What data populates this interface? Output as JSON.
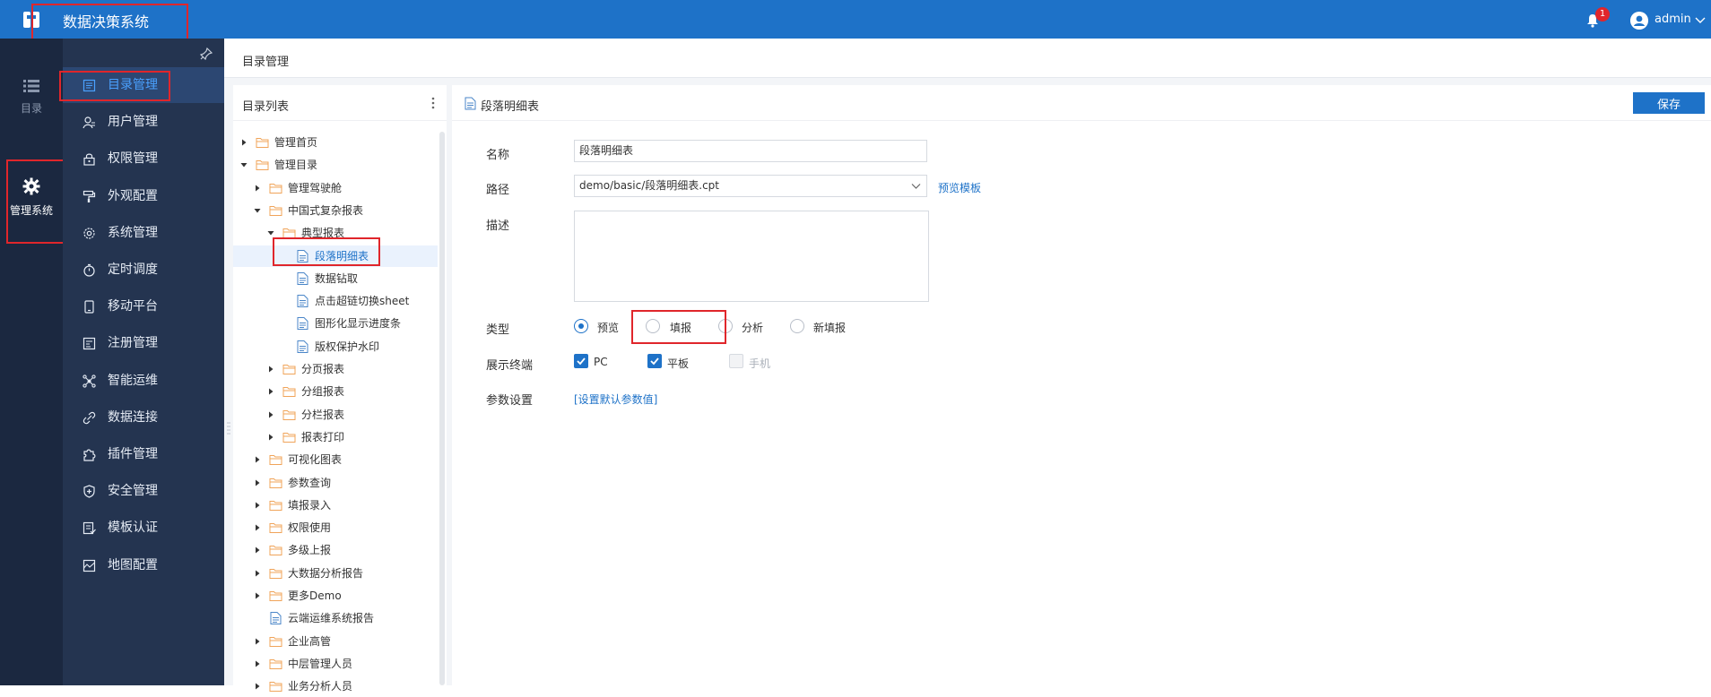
{
  "app": {
    "title": "数据决策系统",
    "user": "admin",
    "notifications": "1"
  },
  "rail": [
    {
      "label": "目录",
      "icon": "list-icon"
    },
    {
      "label": "管理系统",
      "icon": "gear-icon"
    }
  ],
  "menu": [
    {
      "label": "目录管理",
      "icon": "catalog-icon"
    },
    {
      "label": "用户管理",
      "icon": "user-icon"
    },
    {
      "label": "权限管理",
      "icon": "lock-icon"
    },
    {
      "label": "外观配置",
      "icon": "paint-roller-icon"
    },
    {
      "label": "系统管理",
      "icon": "settings-icon"
    },
    {
      "label": "定时调度",
      "icon": "stopwatch-icon"
    },
    {
      "label": "移动平台",
      "icon": "tablet-icon"
    },
    {
      "label": "注册管理",
      "icon": "register-icon"
    },
    {
      "label": "智能运维",
      "icon": "network-icon"
    },
    {
      "label": "数据连接",
      "icon": "link-icon"
    },
    {
      "label": "插件管理",
      "icon": "puzzle-icon"
    },
    {
      "label": "安全管理",
      "icon": "shield-icon"
    },
    {
      "label": "模板认证",
      "icon": "template-icon"
    },
    {
      "label": "地图配置",
      "icon": "map-icon"
    }
  ],
  "breadcrumb": "目录管理",
  "tree": {
    "title": "目录列表",
    "items": [
      {
        "label": "管理首页",
        "level": 0,
        "type": "folder",
        "arrow": "right"
      },
      {
        "label": "管理目录",
        "level": 0,
        "type": "folder",
        "arrow": "down"
      },
      {
        "label": "管理驾驶舱",
        "level": 1,
        "type": "folder",
        "arrow": "right"
      },
      {
        "label": "中国式复杂报表",
        "level": 1,
        "type": "folder",
        "arrow": "down"
      },
      {
        "label": "典型报表",
        "level": 2,
        "type": "folder",
        "arrow": "down"
      },
      {
        "label": "段落明细表",
        "level": 3,
        "type": "file",
        "arrow": "",
        "selected": true
      },
      {
        "label": "数据钻取",
        "level": 3,
        "type": "file",
        "arrow": ""
      },
      {
        "label": "点击超链切换sheet",
        "level": 3,
        "type": "file",
        "arrow": ""
      },
      {
        "label": "图形化显示进度条",
        "level": 3,
        "type": "file",
        "arrow": ""
      },
      {
        "label": "版权保护水印",
        "level": 3,
        "type": "file",
        "arrow": ""
      },
      {
        "label": "分页报表",
        "level": 2,
        "type": "folder",
        "arrow": "right"
      },
      {
        "label": "分组报表",
        "level": 2,
        "type": "folder",
        "arrow": "right"
      },
      {
        "label": "分栏报表",
        "level": 2,
        "type": "folder",
        "arrow": "right"
      },
      {
        "label": "报表打印",
        "level": 2,
        "type": "folder",
        "arrow": "right"
      },
      {
        "label": "可视化图表",
        "level": 1,
        "type": "folder",
        "arrow": "right"
      },
      {
        "label": "参数查询",
        "level": 1,
        "type": "folder",
        "arrow": "right"
      },
      {
        "label": "填报录入",
        "level": 1,
        "type": "folder",
        "arrow": "right"
      },
      {
        "label": "权限使用",
        "level": 1,
        "type": "folder",
        "arrow": "right"
      },
      {
        "label": "多级上报",
        "level": 1,
        "type": "folder",
        "arrow": "right"
      },
      {
        "label": "大数据分析报告",
        "level": 1,
        "type": "folder",
        "arrow": "right"
      },
      {
        "label": "更多Demo",
        "level": 1,
        "type": "folder",
        "arrow": "right"
      },
      {
        "label": "云端运维系统报告",
        "level": 1,
        "type": "file",
        "arrow": ""
      },
      {
        "label": "企业高管",
        "level": 1,
        "type": "folder",
        "arrow": "right"
      },
      {
        "label": "中层管理人员",
        "level": 1,
        "type": "folder",
        "arrow": "right"
      },
      {
        "label": "业务分析人员",
        "level": 1,
        "type": "folder",
        "arrow": "right"
      }
    ]
  },
  "form": {
    "title": "段落明细表",
    "save_label": "保存",
    "name_label": "名称",
    "name_value": "段落明细表",
    "path_label": "路径",
    "path_value": "demo/basic/段落明细表.cpt",
    "preview_link": "预览模板",
    "desc_label": "描述",
    "type_label": "类型",
    "type_options": [
      "预览",
      "填报",
      "分析",
      "新填报"
    ],
    "type_selected": "预览",
    "terminal_label": "展示终端",
    "terminals": [
      {
        "label": "PC",
        "checked": true,
        "disabled": false
      },
      {
        "label": "平板",
        "checked": true,
        "disabled": false
      },
      {
        "label": "手机",
        "checked": false,
        "disabled": true
      }
    ],
    "param_label": "参数设置",
    "param_link": "[设置默认参数值]"
  },
  "colors": {
    "topbar": "#1e72c8",
    "rail": "#1b2840",
    "menu": "#243450",
    "accent": "#1e72c8",
    "highlight": "#e0262b"
  }
}
